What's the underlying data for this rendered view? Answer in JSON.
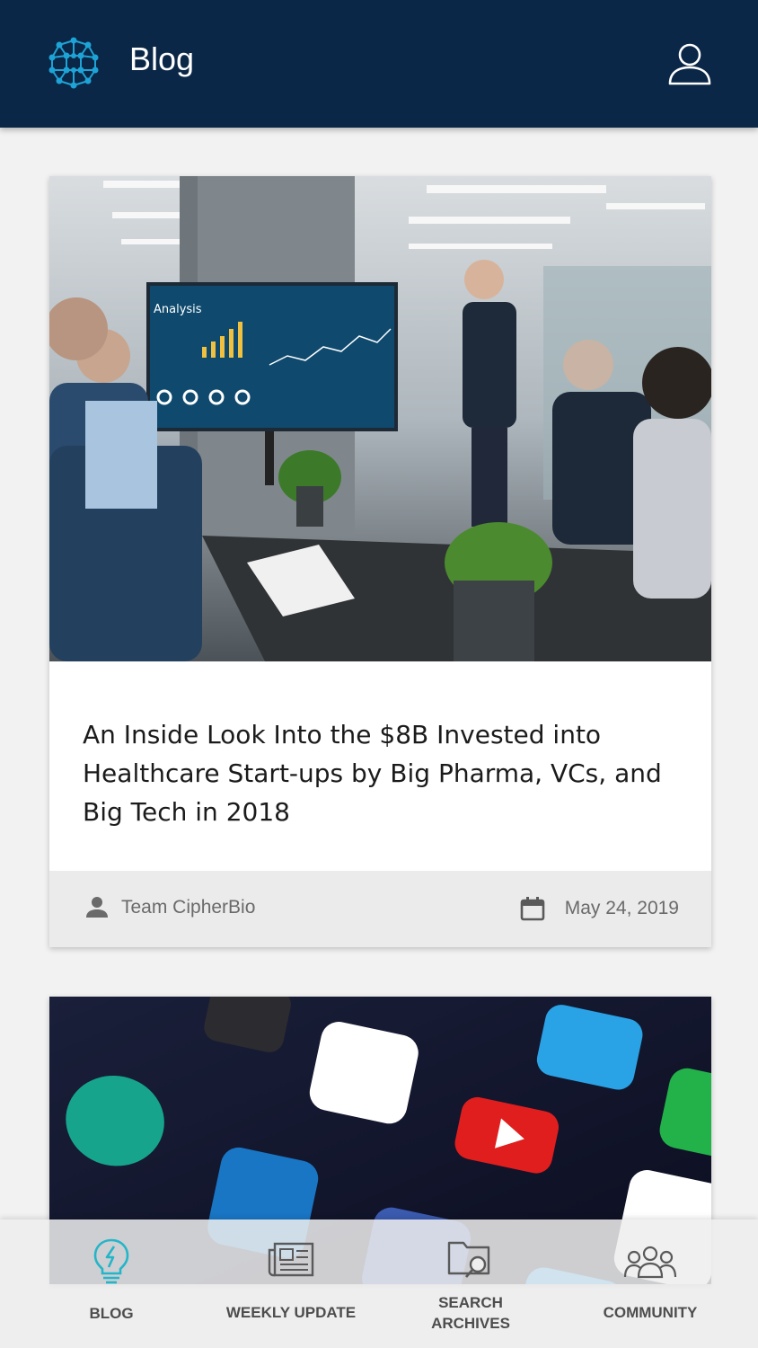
{
  "header": {
    "title": "Blog",
    "logo_icon": "network-logo-icon",
    "profile_icon": "user-profile-icon"
  },
  "posts": [
    {
      "image": "business-meeting-presentation-photo",
      "title": "An Inside Look Into the $8B Invested into Healthcare Start-ups by Big Pharma, VCs, and Big Tech in 2018",
      "author": "Team CipherBio",
      "date": "May 24, 2019"
    },
    {
      "image": "social-media-app-icons-photo"
    }
  ],
  "nav": {
    "blog": "BLOG",
    "weekly_update": "WEEKLY UPDATE",
    "search_archives_line1": "SEARCH",
    "search_archives_line2": "ARCHIVES",
    "community": "COMMUNITY",
    "active": "blog"
  },
  "colors": {
    "header_bg": "#0b2747",
    "accent": "#1ea3d6",
    "nav_active_icon": "#25b5c8",
    "page_bg": "#f2f2f2"
  }
}
